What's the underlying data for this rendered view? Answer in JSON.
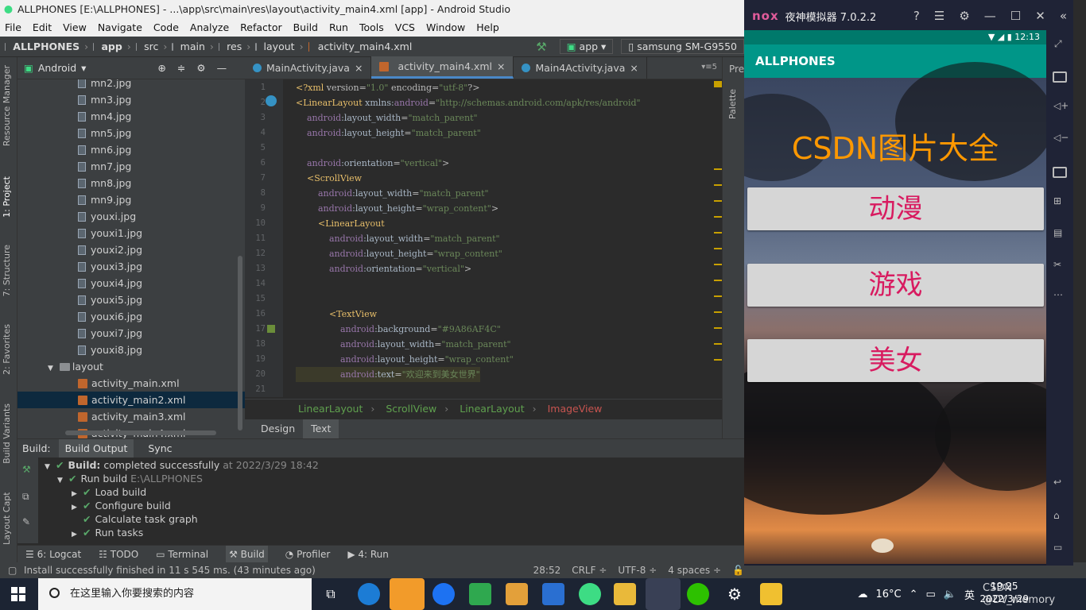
{
  "window_title": "ALLPHONES [E:\\ALLPHONES] - ...\\app\\src\\main\\res\\layout\\activity_main4.xml [app] - Android Studio",
  "menu": [
    "File",
    "Edit",
    "View",
    "Navigate",
    "Code",
    "Analyze",
    "Refactor",
    "Build",
    "Run",
    "Tools",
    "VCS",
    "Window",
    "Help"
  ],
  "nav": {
    "project": "ALLPHONES",
    "module": "app",
    "src": "src",
    "main": "main",
    "res": "res",
    "layout": "layout",
    "file": "activity_main4.xml",
    "run_config": "app",
    "device": "samsung SM-G9550"
  },
  "left_tabs": [
    "Resource Manager",
    "1: Project",
    "7: Structure",
    "2: Favorites",
    "Build Variants",
    "Layout Captures"
  ],
  "project_panel": {
    "view": "Android"
  },
  "tree": [
    "mn2.jpg",
    "mn3.jpg",
    "mn4.jpg",
    "mn5.jpg",
    "mn6.jpg",
    "mn7.jpg",
    "mn8.jpg",
    "mn9.jpg",
    "youxi.jpg",
    "youxi1.jpg",
    "youxi2.jpg",
    "youxi3.jpg",
    "youxi4.jpg",
    "youxi5.jpg",
    "youxi6.jpg",
    "youxi7.jpg",
    "youxi8.jpg"
  ],
  "tree_folder": "layout",
  "tree_layouts": [
    "activity_main.xml",
    "activity_main2.xml",
    "activity_main3.xml",
    "activity_main4.xml"
  ],
  "editor_tabs": [
    "MainActivity.java",
    "activity_main4.xml",
    "Main4Activity.java"
  ],
  "right_panel_label": "Pre",
  "right_tab": "Palette",
  "tab_overflow": "5",
  "code_lines": [
    {
      "n": "1",
      "text": "<?xml version=\"1.0\" encoding=\"utf-8\"?>"
    },
    {
      "n": "2",
      "text": "<LinearLayout xmlns:android=\"http://schemas.android.com/apk/res/android\""
    },
    {
      "n": "3",
      "text": "    android:layout_width=\"match_parent\""
    },
    {
      "n": "4",
      "text": "    android:layout_height=\"match_parent\""
    },
    {
      "n": "5",
      "text": ""
    },
    {
      "n": "6",
      "text": "    android:orientation=\"vertical\">"
    },
    {
      "n": "7",
      "text": "    <ScrollView"
    },
    {
      "n": "8",
      "text": "        android:layout_width=\"match_parent\""
    },
    {
      "n": "9",
      "text": "        android:layout_height=\"wrap_content\">"
    },
    {
      "n": "10",
      "text": "        <LinearLayout"
    },
    {
      "n": "11",
      "text": "            android:layout_width=\"match_parent\""
    },
    {
      "n": "12",
      "text": "            android:layout_height=\"wrap_content\""
    },
    {
      "n": "13",
      "text": "            android:orientation=\"vertical\">"
    },
    {
      "n": "14",
      "text": ""
    },
    {
      "n": "15",
      "text": ""
    },
    {
      "n": "16",
      "text": "            <TextView"
    },
    {
      "n": "17",
      "text": "                android:background=\"#9A86AF4C\""
    },
    {
      "n": "18",
      "text": "                android:layout_width=\"match_parent\""
    },
    {
      "n": "19",
      "text": "                android:layout_height=\"wrap_content\""
    },
    {
      "n": "20",
      "text": "                android:text=\"欢迎来到美女世界\""
    },
    {
      "n": "21",
      "text": ""
    }
  ],
  "breadcrumb": [
    "LinearLayout",
    "ScrollView",
    "LinearLayout",
    "ImageView"
  ],
  "design_tabs": [
    "Design",
    "Text"
  ],
  "build_panel": {
    "label": "Build:",
    "tabs": [
      "Build Output",
      "Sync"
    ]
  },
  "build_rows": [
    {
      "bold": "Build:",
      "rest": " completed successfully",
      "time": " at 2022/3/29 18:42"
    },
    {
      "text": "Run build",
      "path": " E:\\ALLPHONES"
    },
    {
      "text": "Load build"
    },
    {
      "text": "Configure build"
    },
    {
      "text": "Calculate task graph"
    },
    {
      "text": "Run tasks"
    }
  ],
  "bottom_tools": [
    "6: Logcat",
    "TODO",
    "Terminal",
    "Build",
    "Profiler",
    "4: Run"
  ],
  "status": {
    "message": "Install successfully finished in 11 s 545 ms. (43 minutes ago)",
    "position": "28:52",
    "line_sep": "CRLF ÷",
    "encoding": "UTF-8 ÷",
    "indent": "4 spaces ÷"
  },
  "emulator": {
    "logo": "nox",
    "title": "夜神模拟器 7.0.2.2",
    "time": "12:13",
    "app_name": "ALLPHONES",
    "heading": "CSDN图片大全",
    "buttons": [
      "动漫",
      "游戏",
      "美女"
    ],
    "accent": "#009688",
    "heading_color": "#ff9800",
    "button_text_color": "#d81b60"
  },
  "taskbar": {
    "search_placeholder": "在这里输入你要搜索的内容",
    "weather": "16°C",
    "ime": "英",
    "clock_time": "19:25",
    "clock_date": "2022/3/29",
    "watermark": "CSDN @DY_memory"
  }
}
